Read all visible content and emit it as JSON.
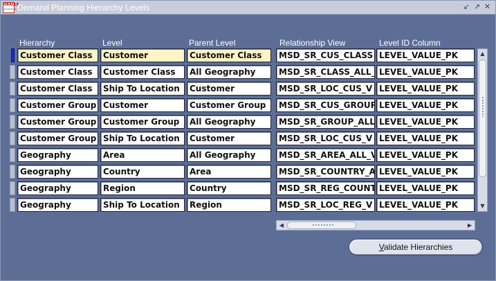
{
  "window": {
    "title": "Demand Planning Hierarchy Levels",
    "app_icon_line1": "ORACLE",
    "app_icon_line2": "Applications"
  },
  "columns": {
    "hierarchy": "Hierarchy",
    "level": "Level",
    "parent_level": "Parent Level",
    "relationship_view": "Relationship View",
    "level_id_column": "Level ID Column"
  },
  "rows": [
    {
      "hierarchy": "Customer Class",
      "level": "Customer",
      "parent_level": "Customer Class",
      "relationship_view": "MSD_SR_CUS_CLASS",
      "level_id_column": "LEVEL_VALUE_PK"
    },
    {
      "hierarchy": "Customer Class",
      "level": "Customer Class",
      "parent_level": "All Geography",
      "relationship_view": "MSD_SR_CLASS_ALL_",
      "level_id_column": "LEVEL_VALUE_PK"
    },
    {
      "hierarchy": "Customer Class",
      "level": "Ship To Location",
      "parent_level": "Customer",
      "relationship_view": "MSD_SR_LOC_CUS_V",
      "level_id_column": "LEVEL_VALUE_PK"
    },
    {
      "hierarchy": "Customer Group",
      "level": "Customer",
      "parent_level": "Customer Group",
      "relationship_view": "MSD_SR_CUS_GROUP",
      "level_id_column": "LEVEL_VALUE_PK"
    },
    {
      "hierarchy": "Customer Group",
      "level": "Customer Group",
      "parent_level": "All Geography",
      "relationship_view": "MSD_SR_GROUP_ALL_",
      "level_id_column": "LEVEL_VALUE_PK"
    },
    {
      "hierarchy": "Customer Group",
      "level": "Ship To Location",
      "parent_level": "Customer",
      "relationship_view": "MSD_SR_LOC_CUS_V",
      "level_id_column": "LEVEL_VALUE_PK"
    },
    {
      "hierarchy": "Geography",
      "level": "Area",
      "parent_level": "All Geography",
      "relationship_view": "MSD_SR_AREA_ALL_V",
      "level_id_column": "LEVEL_VALUE_PK"
    },
    {
      "hierarchy": "Geography",
      "level": "Country",
      "parent_level": "Area",
      "relationship_view": "MSD_SR_COUNTRY_A",
      "level_id_column": "LEVEL_VALUE_PK"
    },
    {
      "hierarchy": "Geography",
      "level": "Region",
      "parent_level": "Country",
      "relationship_view": "MSD_SR_REG_COUNT",
      "level_id_column": "LEVEL_VALUE_PK"
    },
    {
      "hierarchy": "Geography",
      "level": "Ship To Location",
      "parent_level": "Region",
      "relationship_view": "MSD_SR_LOC_REG_V",
      "level_id_column": "LEVEL_VALUE_PK"
    }
  ],
  "selected_row": 0,
  "buttons": {
    "validate_mnemonic": "V",
    "validate_rest": "alidate Hierarchies"
  }
}
